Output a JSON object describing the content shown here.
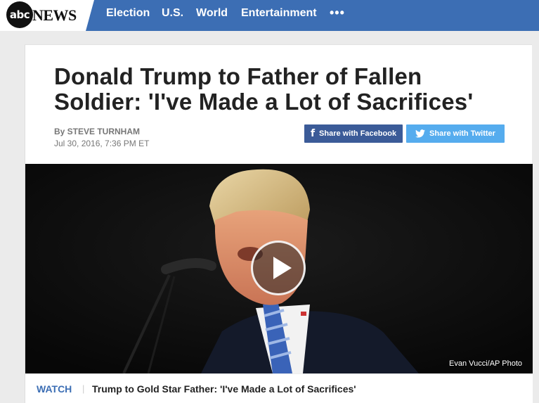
{
  "header": {
    "logo_circle": "abc",
    "logo_text": "NEWS",
    "nav": [
      "Election",
      "U.S.",
      "World",
      "Entertainment"
    ],
    "more": "•••",
    "colors": {
      "nav_bg": "#3c6eb4"
    }
  },
  "article": {
    "title": "Donald Trump to Father of Fallen Soldier: 'I've Made a Lot of Sacrifices'",
    "byline": "By STEVE TURNHAM",
    "date": "Jul 30, 2016, 7:36 PM ET"
  },
  "share": {
    "facebook_label": "Share with Facebook",
    "twitter_label": "Share with Twitter",
    "colors": {
      "facebook": "#3b5b98",
      "twitter": "#55acee"
    }
  },
  "video": {
    "credit": "Evan Vucci/AP Photo",
    "play_icon": "play-icon"
  },
  "watch": {
    "label": "WATCH",
    "separator": "|",
    "title": "Trump to Gold Star Father: 'I've Made a Lot of Sacrifices'"
  }
}
